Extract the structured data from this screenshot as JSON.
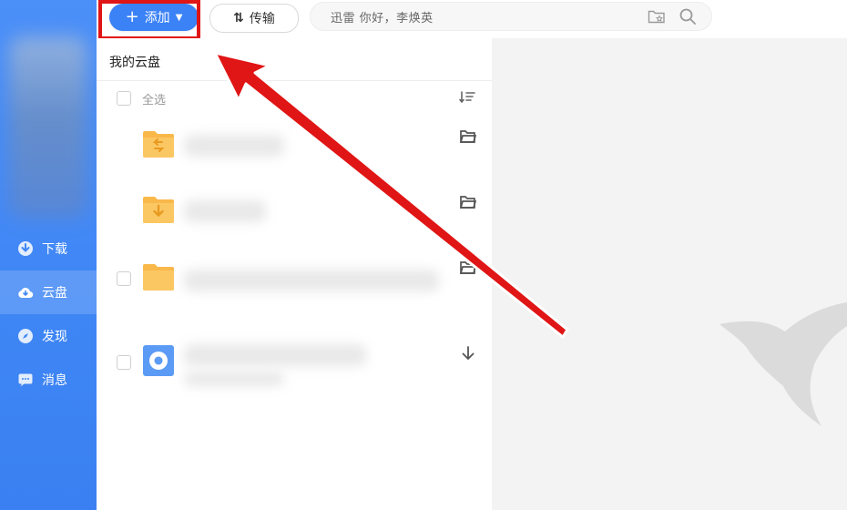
{
  "sidebar": {
    "items": [
      {
        "label": "下载",
        "icon": "download-icon"
      },
      {
        "label": "云盘",
        "icon": "cloud-icon",
        "active": true
      },
      {
        "label": "发现",
        "icon": "compass-icon"
      },
      {
        "label": "消息",
        "icon": "message-icon"
      }
    ]
  },
  "toolbar": {
    "add_label": "添加",
    "transfer_label": "传输",
    "search_placeholder": "迅雷   你好，李焕英"
  },
  "main": {
    "breadcrumb": "我的云盘",
    "select_all_label": "全选"
  },
  "colors": {
    "sidebar": "#3f86f5",
    "accent": "#3b82f6",
    "annotation": "#e01515",
    "folder": "#f9b84a"
  }
}
